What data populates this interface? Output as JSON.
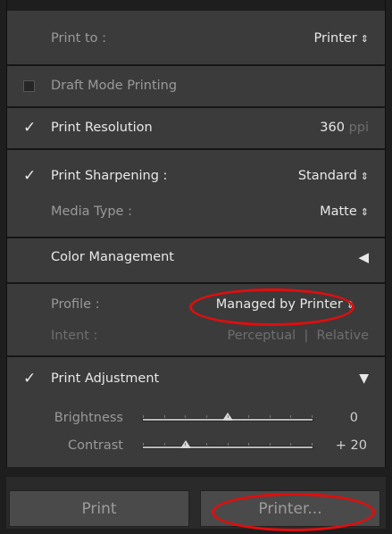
{
  "print_to": {
    "label": "Print to :",
    "value": "Printer",
    "updown": "⇕"
  },
  "draft_mode": {
    "label": "Draft Mode Printing",
    "checked": false
  },
  "print_resolution": {
    "label": "Print Resolution",
    "value": "360",
    "unit": "ppi",
    "checked": true,
    "tick": "✓"
  },
  "print_sharpening": {
    "label": "Print Sharpening :",
    "value": "Standard",
    "checked": true,
    "tick": "✓",
    "updown": "⇕"
  },
  "media_type": {
    "label": "Media Type :",
    "value": "Matte",
    "updown": "⇕"
  },
  "color_management": {
    "label": "Color Management",
    "arrow": "◀"
  },
  "profile": {
    "label": "Profile :",
    "value": "Managed by Printer",
    "updown": "⇕"
  },
  "intent": {
    "label": "Intent :",
    "option1": "Perceptual",
    "divider": "|",
    "option2": "Relative"
  },
  "print_adjustment": {
    "label": "Print Adjustment",
    "checked": true,
    "tick": "✓",
    "arrow": "▼"
  },
  "brightness": {
    "label": "Brightness",
    "value": "0",
    "level": 0.5
  },
  "contrast": {
    "label": "Contrast",
    "value": "+ 20",
    "level": 0.25
  },
  "buttons": {
    "print": "Print",
    "printer": "Printer..."
  },
  "colors": {
    "highlight_oval": "#e20d0d",
    "panel_bg": "#3b3b3b"
  }
}
